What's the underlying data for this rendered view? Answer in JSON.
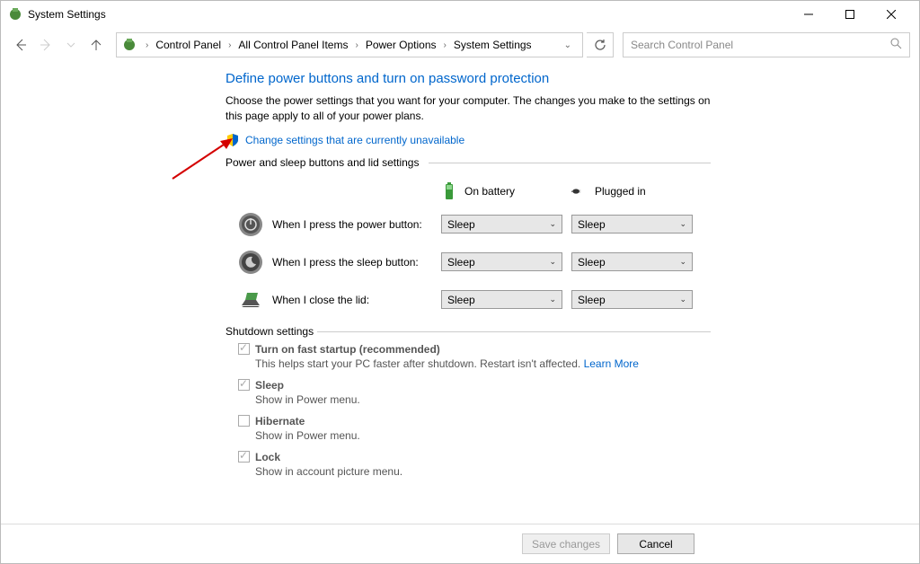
{
  "titlebar": {
    "title": "System Settings"
  },
  "breadcrumb": {
    "items": [
      "Control Panel",
      "All Control Panel Items",
      "Power Options",
      "System Settings"
    ]
  },
  "search": {
    "placeholder": "Search Control Panel"
  },
  "page": {
    "heading": "Define power buttons and turn on password protection",
    "description": "Choose the power settings that you want for your computer. The changes you make to the settings on this page apply to all of your power plans.",
    "change_link": "Change settings that are currently unavailable"
  },
  "section1": {
    "title": "Power and sleep buttons and lid settings",
    "col_battery": "On battery",
    "col_plugged": "Plugged in",
    "rows": [
      {
        "label": "When I press the power button:",
        "battery": "Sleep",
        "plugged": "Sleep"
      },
      {
        "label": "When I press the sleep button:",
        "battery": "Sleep",
        "plugged": "Sleep"
      },
      {
        "label": "When I close the lid:",
        "battery": "Sleep",
        "plugged": "Sleep"
      }
    ]
  },
  "section2": {
    "title": "Shutdown settings",
    "items": [
      {
        "label": "Turn on fast startup (recommended)",
        "checked": true,
        "desc": "This helps start your PC faster after shutdown. Restart isn't affected. ",
        "link": "Learn More"
      },
      {
        "label": "Sleep",
        "checked": true,
        "desc": "Show in Power menu."
      },
      {
        "label": "Hibernate",
        "checked": false,
        "desc": "Show in Power menu."
      },
      {
        "label": "Lock",
        "checked": true,
        "desc": "Show in account picture menu."
      }
    ]
  },
  "buttons": {
    "save": "Save changes",
    "cancel": "Cancel"
  }
}
